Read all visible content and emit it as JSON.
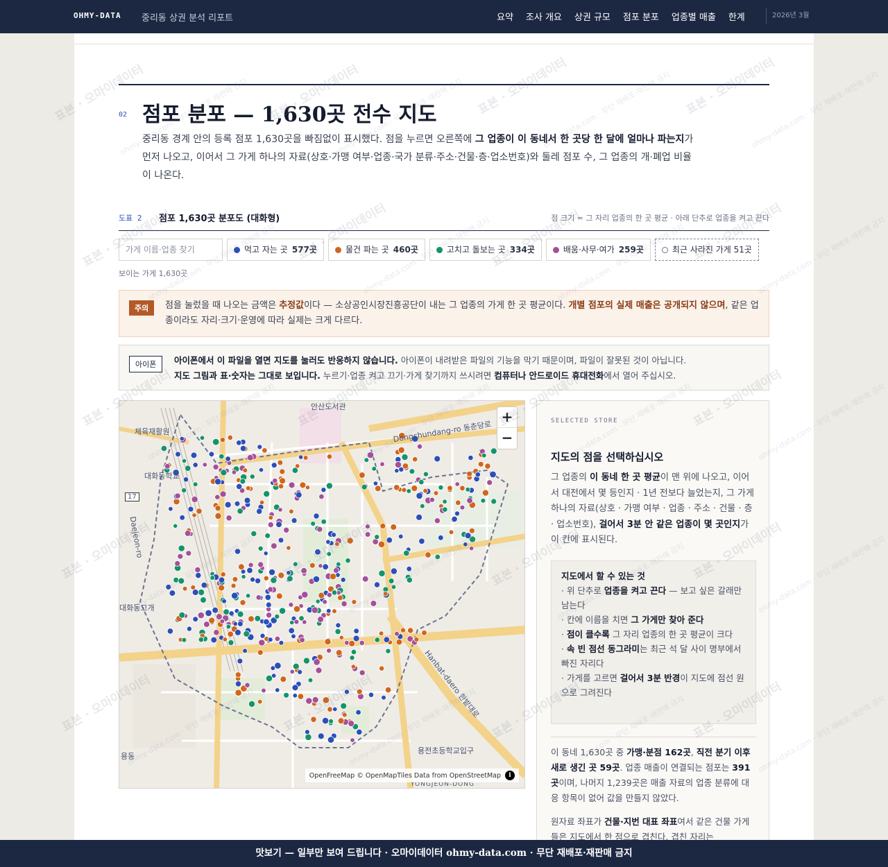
{
  "nav": {
    "brand": "OHMY-DATA",
    "report_title": "중리동 상권 분석 리포트",
    "links": [
      "요약",
      "조사 개요",
      "상권 규모",
      "점포 분포",
      "업종별 매출",
      "한계"
    ],
    "date": "2026년 3월"
  },
  "section": {
    "number": "02",
    "title": "점포 분포 — 1,630곳 전수 지도",
    "desc_1": "중리동 경계 안의 등록 점포 1,630곳을 빠짐없이 표시했다. 점을 누르면 오른쪽에 ",
    "desc_bold": "그 업종이 이 동네서 한 곳당 한 달에 얼마나 파는지",
    "desc_2": "가 먼저 나오고, 이어서 그 가게 하나의 자료(상호·가맹 여부·업종·국가 분류·주소·건물·층·업소번호)와 둘레 점포 수, 그 업종의 개·폐업 비율이 나온다."
  },
  "figure": {
    "label": "도표 2",
    "title": "점포 1,630곳 분포도 (대화형)",
    "note": "점 크기 = 그 자리 업종의 한 곳 평균 · 아래 단추로 업종을 켜고 끈다"
  },
  "filters": {
    "search_placeholder": "가게 이름·업종 찾기",
    "chips": [
      {
        "label": "먹고 자는 곳",
        "count": "577곳",
        "color": "#2c4fb8"
      },
      {
        "label": "물건 파는 곳",
        "count": "460곳",
        "color": "#d0661c"
      },
      {
        "label": "고치고 돌보는 곳",
        "count": "334곳",
        "color": "#14946a"
      },
      {
        "label": "배움·사무·여가",
        "count": "259곳",
        "color": "#a4509a"
      }
    ],
    "closed_chip": "최근 사라진 가게 51곳",
    "visible_count": "보이는 가게 1,630곳"
  },
  "caution": {
    "tag": "주의",
    "text_1": "점을 눌렀을 때 나오는 금액은 ",
    "bold_1": "추정값",
    "text_2": "이다 — 소상공인시장진흥공단이 내는 그 업종의 가게 한 곳 평균이다. ",
    "bold_2": "개별 점포의 실제 매출은 공개되지 않으며",
    "text_3": ", 같은 업종이라도 자리·크기·운영에 따라 실제는 크게 다르다."
  },
  "ios": {
    "tag": "아이폰",
    "bold_1": "아이폰에서 이 파일을 열면 지도를 눌러도 반응하지 않습니다.",
    "text_1": " 아이폰이 내려받은 파일의 기능을 막기 때문이며, 파일이 잘못된 것이 아닙니다.",
    "bold_2": "지도 그림과 표·숫자는 그대로 보입니다.",
    "text_2": " 누르기·업종 켜고 끄기·가게 찾기까지 쓰시려면 ",
    "bold_3": "컴퓨터나 안드로이드 휴대전화",
    "text_3": "에서 열어 주십시오."
  },
  "map": {
    "zoom_in": "+",
    "zoom_out": "−",
    "attribution_1": "OpenFreeMap © OpenMapTiles ",
    "attribution_2": "Data from OpenStreetMap",
    "labels": {
      "library": "안산도서관",
      "road1": "Dongchundang-ro 동춘당로",
      "gym": "체육재활원",
      "school1": "대화동학교",
      "route": "17",
      "daejeon": "Daejeon-ro",
      "gogae": "대화동고개",
      "hanbat": "Hanbat-daero 한밭대로",
      "school2": "용전초등학교입구",
      "yongjeon": "YONGJEON-DONG",
      "station": "용동"
    }
  },
  "panel": {
    "eyebrow": "SELECTED STORE",
    "title": "지도의 점을 선택하십시오",
    "body_1": "그 업종의 ",
    "body_b1": "이 동네 한 곳 평균",
    "body_2": "이 맨 위에 나오고, 이어서 대전에서 몇 등인지 · 1년 전보다 늘었는지, 그 가게 하나의 자료(상호 · 가맹 여부 · 업종 · 주소 · 건물 · 층 · 업소번호), ",
    "body_b2": "걸어서 3분 안 같은 업종이 몇 곳인지",
    "body_3": "가 이 칸에 표시된다.",
    "howto_title": "지도에서 할 수 있는 것",
    "howto_1a": "· 위 단추로 ",
    "howto_1b": "업종을 켜고 끈다",
    "howto_1c": " — 보고 싶은 갈래만 남는다",
    "howto_2a": "· 칸에 이름을 치면 ",
    "howto_2b": "그 가게만 찾아 준다",
    "howto_3a": "· ",
    "howto_3b": "점이 클수록",
    "howto_3c": " 그 자리 업종의 한 곳 평균이 크다",
    "howto_4a": "· ",
    "howto_4b": "속 빈 점선 동그라미",
    "howto_4c": "는 최근 석 달 사이 명부에서 빠진 자리다",
    "howto_5a": "· 가게를 고르면 ",
    "howto_5b": "걸어서 3분 반경",
    "howto_5c": "이 지도에 점선 원으로 그려진다",
    "stats_1": "이 동네 1,630곳 중 ",
    "stats_b1": "가맹·분점 162곳",
    "stats_2": ", ",
    "stats_b2": "직전 분기 이후 새로 생긴 곳 59곳",
    "stats_3": ". 업종 매출이 연결되는 점포는 ",
    "stats_b3": "391곳",
    "stats_4": "이며, 나머지 1,239곳은 매출 자료의 업종 분류에 대응 항목이 없어 값을 만들지 않았다.",
    "src_1": "원자료 좌표가 ",
    "src_b1": "건물·지번 대표 좌표",
    "src_2": "여서 같은 건물 가게들은 지도에서 한 점으로 겹친다. 겹친 자리는"
  },
  "watermark": {
    "text": "표본 · 오마이데이터",
    "small": "ohmy-data.com · 무단 재배포·재판매 금지"
  },
  "footer": {
    "text": "맛보기 — 일부만 보여 드립니다 · 오마이데이터 ohmy-data.com · 무단 재배포·재판매 금지"
  }
}
